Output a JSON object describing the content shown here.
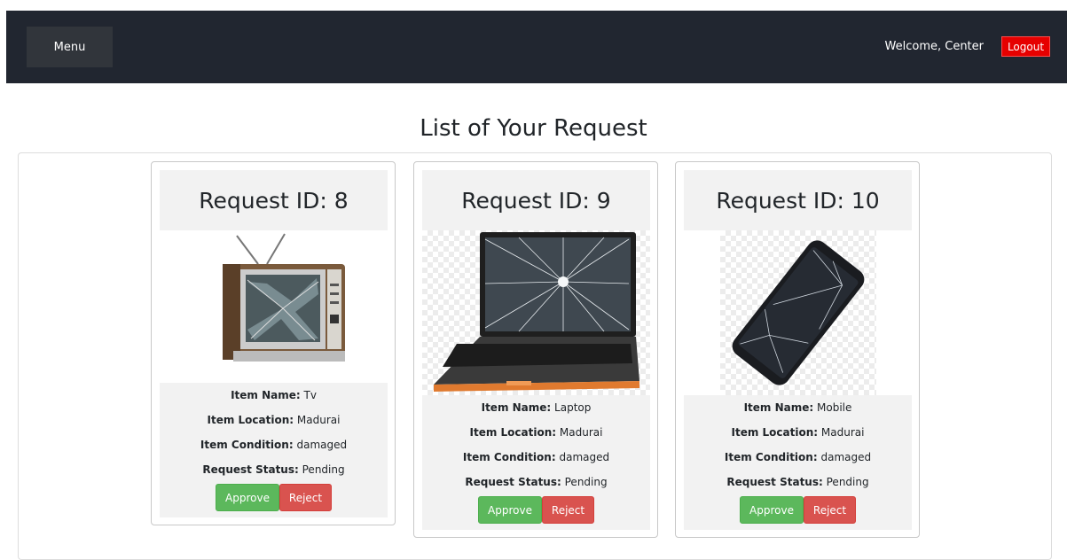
{
  "navbar": {
    "menu_label": "Menu",
    "welcome_text": "Welcome, Center",
    "logout_label": "Logout"
  },
  "page": {
    "title": "List of Your Request"
  },
  "labels": {
    "item_name": "Item Name:",
    "item_location": "Item Location:",
    "item_condition": "Item Condition:",
    "request_status": "Request Status:",
    "approve": "Approve",
    "reject": "Reject"
  },
  "requests": [
    {
      "title": "Request ID: 8",
      "item_name": "Tv",
      "item_location": "Madurai",
      "item_condition": "damaged",
      "request_status": "Pending",
      "image": "broken-tv-image"
    },
    {
      "title": "Request ID: 9",
      "item_name": "Laptop",
      "item_location": "Madurai",
      "item_condition": "damaged",
      "request_status": "Pending",
      "image": "broken-laptop-image"
    },
    {
      "title": "Request ID: 10",
      "item_name": "Mobile",
      "item_location": "Madurai",
      "item_condition": "damaged",
      "request_status": "Pending",
      "image": "broken-mobile-image"
    }
  ],
  "colors": {
    "navbar_bg": "#212630",
    "logout_bg": "#e60000",
    "approve_bg": "#5cb85c",
    "reject_bg": "#d9534f"
  }
}
